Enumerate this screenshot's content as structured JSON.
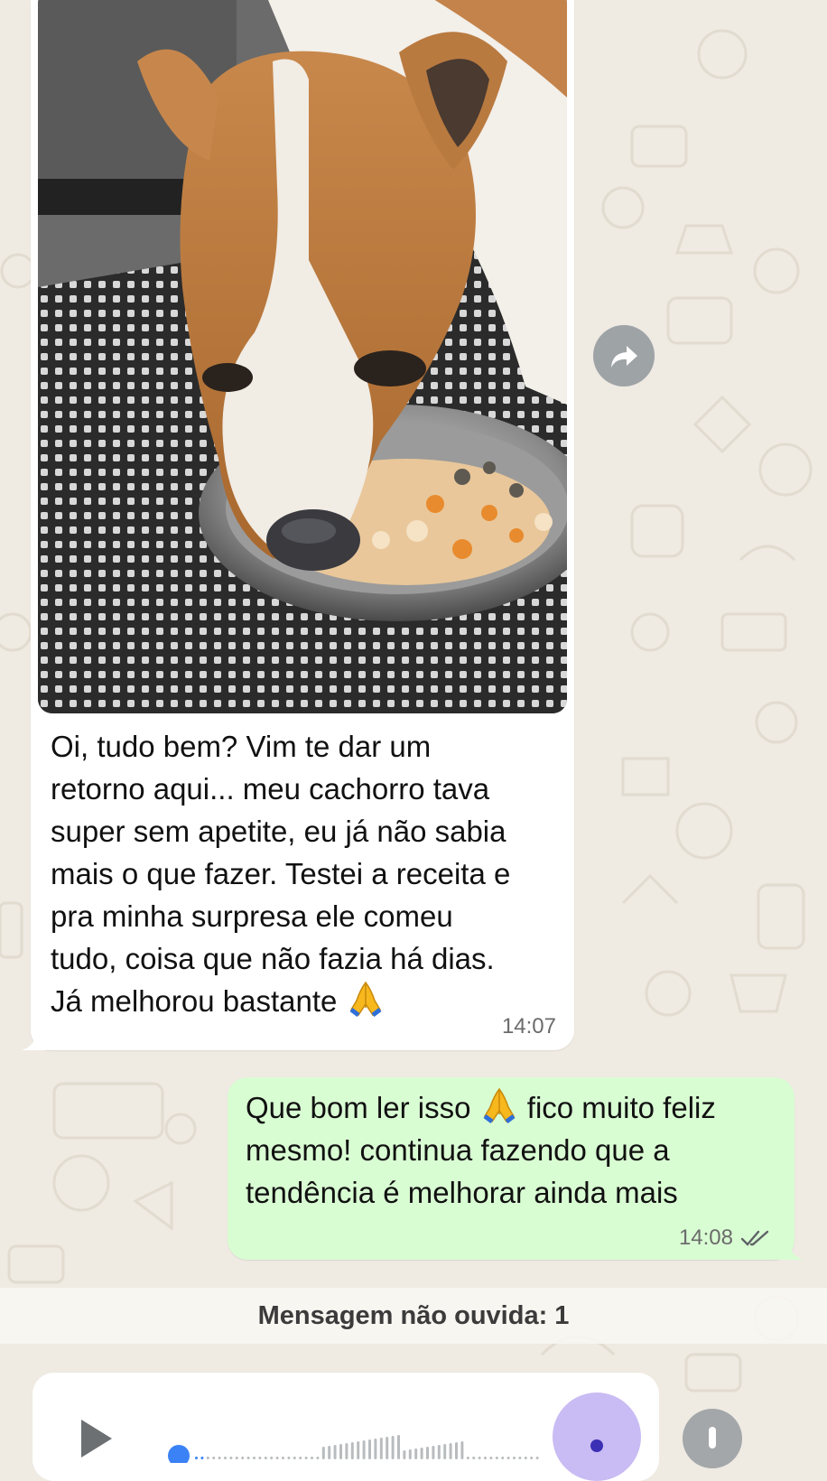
{
  "chat": {
    "incoming_message": {
      "text_lines": [
        "Oi, tudo bem? Vim te dar um",
        "retorno aqui... meu cachorro tava",
        "super sem apetite, eu já não sabia",
        "mais o que fazer. Testei a receita e",
        "pra minha surpresa ele comeu",
        "tudo, coisa que não fazia há dias.",
        "Já melhorou bastante"
      ],
      "emoji": "folded-hands",
      "time": "14:07",
      "photo_subject": "dog-eating-icon"
    },
    "outgoing_message": {
      "line1_before_emoji": "Que bom ler isso",
      "line1_after_emoji": "fico muito feliz",
      "line2": "mesmo! continua fazendo que a",
      "line3": "tendência é melhorar ainda mais",
      "emoji": "folded-hands",
      "time": "14:08",
      "status": "read"
    },
    "unread_divider": "Mensagem não ouvida: 1",
    "voice_message": {
      "played_fraction": 0.02
    }
  },
  "colors": {
    "background": "#efeae2",
    "incoming_bubble": "#ffffff",
    "outgoing_bubble": "#d9fdd3",
    "timestamp": "#6b6b6b",
    "voice_accent": "#3b82f6",
    "voice_avatar": "#c9bbf3"
  },
  "icons": {
    "forward": "forward-icon",
    "read_receipt": "double-check-icon",
    "play": "play-icon",
    "emoji": "folded-hands-icon"
  }
}
